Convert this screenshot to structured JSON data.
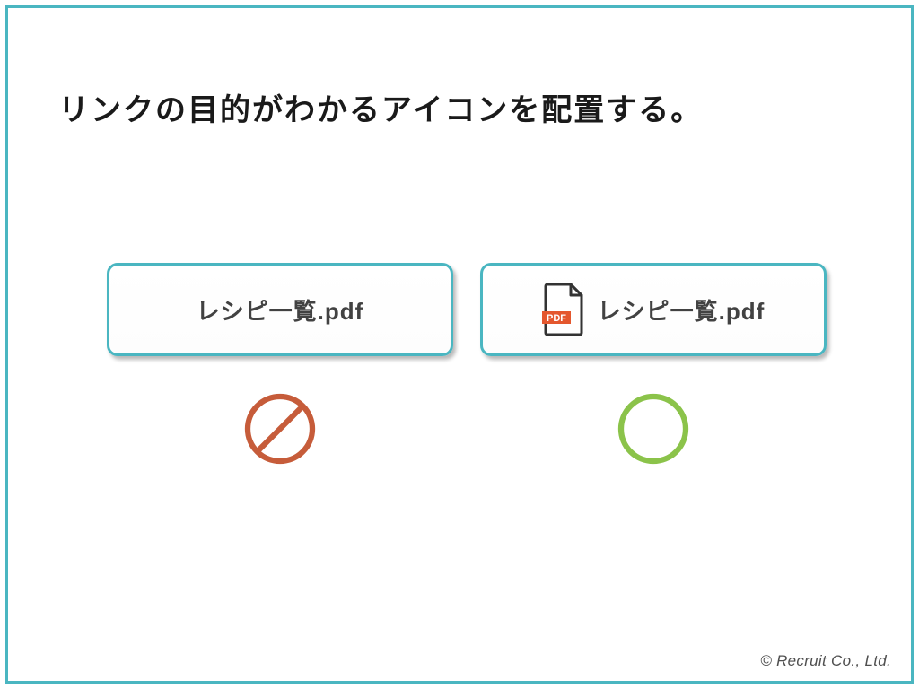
{
  "title": "リンクの目的がわかるアイコンを配置する。",
  "cards": {
    "left": {
      "label": "レシピ一覧.pdf"
    },
    "right": {
      "label": "レシピ一覧.pdf",
      "icon_badge": "PDF"
    }
  },
  "footer": "© Recruit Co., Ltd.",
  "colors": {
    "frame": "#4AB6C1",
    "bad": "#C65C3A",
    "good": "#8BC34A",
    "pdf": "#E4572E"
  }
}
